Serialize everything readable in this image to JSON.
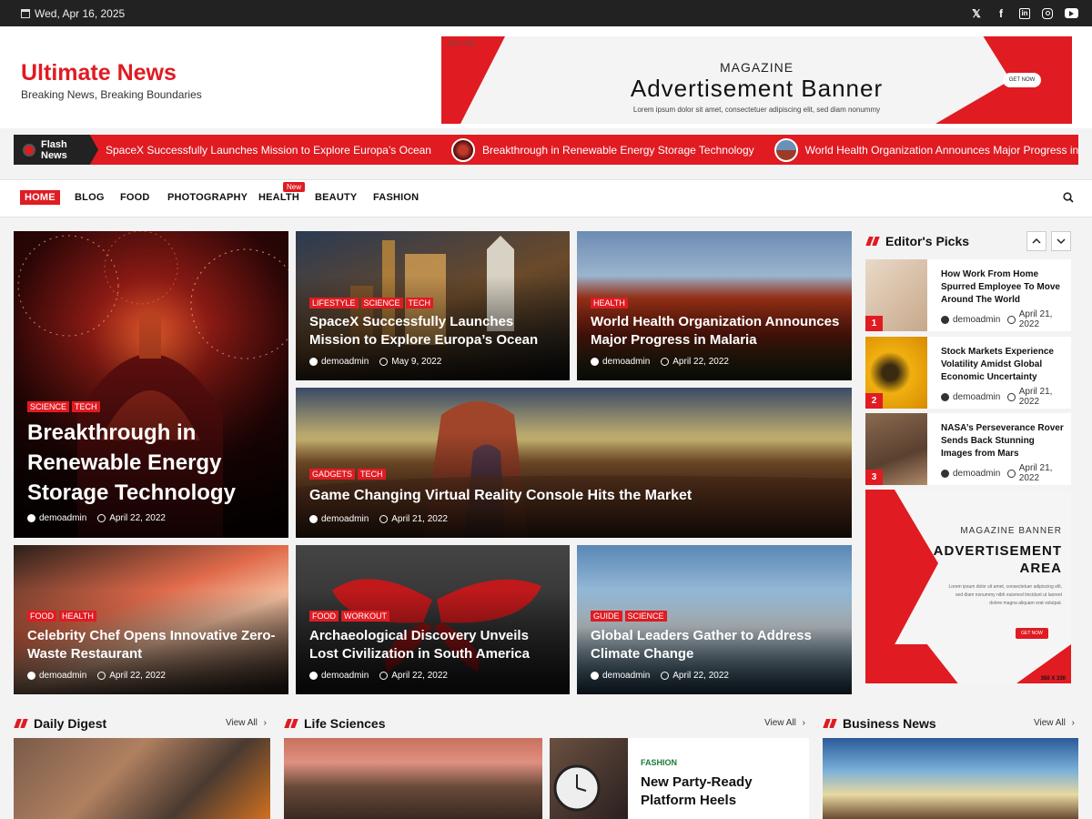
{
  "topbar": {
    "date": "Wed, Apr 16, 2025",
    "social": [
      "x-icon",
      "facebook-icon",
      "linkedin-icon",
      "instagram-icon",
      "youtube-icon"
    ]
  },
  "header": {
    "site_title": "Ultimate News",
    "tagline": "Breaking News, Breaking Boundaries",
    "ad": {
      "size": "720 x 100",
      "line1": "MAGAZINE",
      "line2": "Advertisement Banner",
      "line3": "Lorem ipsum dolor sit amet, consectetuer adipiscing elit, sed diam nonummy",
      "cta": "GET NOW"
    }
  },
  "flash": {
    "label": "Flash News",
    "items": [
      "SpaceX Successfully Launches Mission to Explore Europa’s Ocean",
      "Breakthrough in Renewable Energy Storage Technology",
      "World Health Organization Announces Major Progress in Malari"
    ]
  },
  "nav": {
    "items": [
      "HOME",
      "BLOG",
      "FOOD",
      "PHOTOGRAPHY",
      "HEALTH",
      "BEAUTY",
      "FASHION"
    ],
    "badge": "New"
  },
  "hero": [
    {
      "tags": [
        "SCIENCE",
        "TECH"
      ],
      "title": "Breakthrough in Renewable Energy Storage Technology",
      "author": "demoadmin",
      "date": "April 22, 2022"
    },
    {
      "tags": [
        "LIFESTYLE",
        "SCIENCE",
        "TECH"
      ],
      "title": "SpaceX Successfully Launches Mission to Explore Europa’s Ocean",
      "author": "demoadmin",
      "date": "May 9, 2022"
    },
    {
      "tags": [
        "HEALTH"
      ],
      "title": "World Health Organization Announces Major Progress in Malaria",
      "author": "demoadmin",
      "date": "April 22, 2022"
    },
    {
      "tags": [
        "GADGETS",
        "TECH"
      ],
      "title": "Game Changing Virtual Reality Console Hits the Market",
      "author": "demoadmin",
      "date": "April 21, 2022"
    },
    {
      "tags": [
        "FOOD",
        "HEALTH"
      ],
      "title": "Celebrity Chef Opens Innovative Zero-Waste Restaurant",
      "author": "demoadmin",
      "date": "April 22, 2022"
    },
    {
      "tags": [
        "FOOD",
        "WORKOUT"
      ],
      "title": " Archaeological Discovery Unveils Lost Civilization in South America",
      "author": "demoadmin",
      "date": "April 22, 2022"
    },
    {
      "tags": [
        "GUIDE",
        "SCIENCE"
      ],
      "title": "Global Leaders Gather to Address Climate Change",
      "author": "demoadmin",
      "date": "April 22, 2022"
    }
  ],
  "sidebar": {
    "title": "Editor's Picks",
    "picks": [
      {
        "num": "1",
        "title": "How Work From Home Spurred Employee To Move Around The World",
        "author": "demoadmin",
        "date": "April 21, 2022"
      },
      {
        "num": "2",
        "title": "Stock Markets Experience Volatility Amidst Global Economic Uncertainty",
        "author": "demoadmin",
        "date": "April 21, 2022"
      },
      {
        "num": "3",
        "title": "NASA’s Perseverance Rover Sends Back Stunning Images from Mars",
        "author": "demoadmin",
        "date": "April 21, 2022"
      }
    ],
    "ad": {
      "line1": "MAGAZINE BANNER",
      "line2": "ADVERTISEMENT",
      "line3": "AREA",
      "text": "Lorem ipsum dolor sit amet, consectetuer adipiscing elit, sed diam nonummy nibh euismod tincidunt ut laoreet dolore magna aliquam erat volutpat.",
      "cta": "GET NOW",
      "size": "350 X 330"
    }
  },
  "sections": {
    "daily_digest": "Daily Digest",
    "life_sciences": "Life Sciences",
    "business_news": "Business News",
    "view_all": "View All",
    "fashion_card": {
      "category": "FASHION",
      "title": "New Party-Ready Platform Heels"
    }
  },
  "colors": {
    "accent": "#e01b22",
    "dark": "#222222"
  }
}
